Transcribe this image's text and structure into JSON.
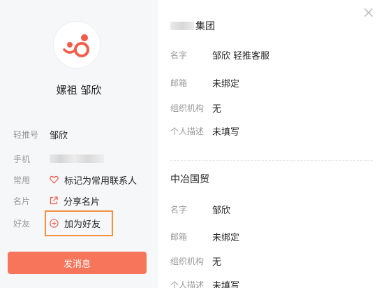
{
  "profile": {
    "display_name": "嫘祖 邹欣",
    "fields": [
      {
        "label": "轻推号",
        "value": "邹欣"
      },
      {
        "label": "手机",
        "value": ""
      },
      {
        "label": "常用",
        "value": "标记为常用联系人"
      },
      {
        "label": "名片",
        "value": "分享名片"
      },
      {
        "label": "好友",
        "value": "加为好友"
      }
    ],
    "send_button": "发消息"
  },
  "orgs": [
    {
      "title_suffix": "集团",
      "fields": [
        {
          "label": "名字",
          "value": "邹欣 轻推客服"
        },
        {
          "label": "邮箱",
          "value": "未绑定"
        },
        {
          "label": "组织机构",
          "value": "无"
        },
        {
          "label": "个人描述",
          "value": "未填写"
        }
      ]
    },
    {
      "title": "中冶国贸",
      "fields": [
        {
          "label": "名字",
          "value": "邹欣"
        },
        {
          "label": "邮箱",
          "value": "未绑定"
        },
        {
          "label": "组织机构",
          "value": "无"
        },
        {
          "label": "个人描述",
          "value": "未填写"
        }
      ]
    }
  ],
  "colors": {
    "accent": "#f7755a",
    "highlight": "#f3913f",
    "label": "#9a9a9a",
    "sidebar_bg": "#f6f7f9"
  },
  "icons": [
    "app-logo-icon",
    "heart-icon",
    "share-icon",
    "add-friend-icon",
    "close-icon"
  ]
}
